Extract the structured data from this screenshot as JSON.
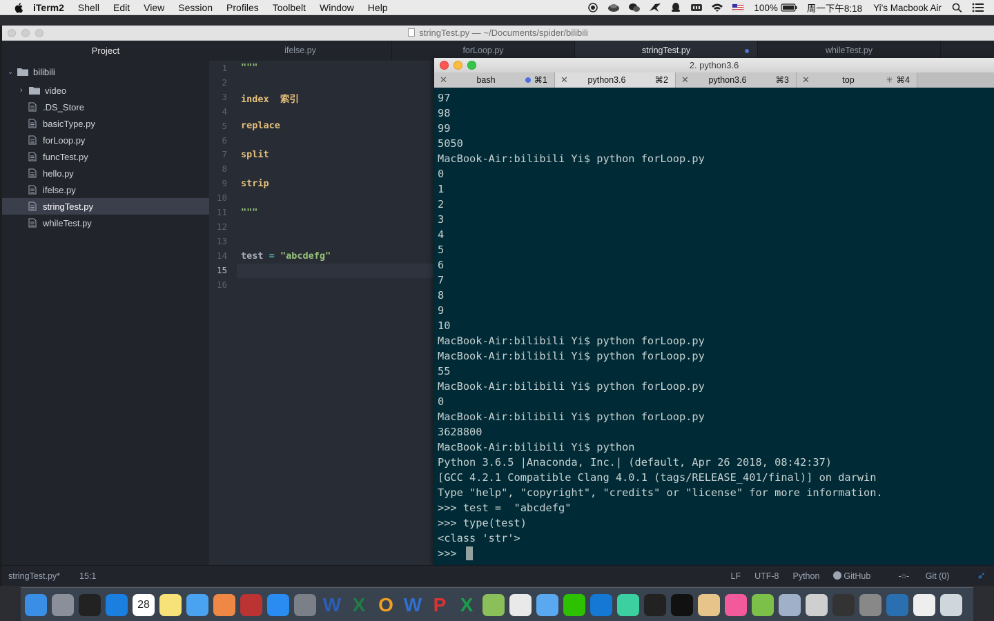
{
  "menubar": {
    "app": "iTerm2",
    "items": [
      "Shell",
      "Edit",
      "View",
      "Session",
      "Profiles",
      "Toolbelt",
      "Window",
      "Help"
    ],
    "battery": "100%",
    "datetime": "周一下午8:18",
    "computer_name": "Yi's Macbook Air"
  },
  "window_title": "stringTest.py — ~/Documents/spider/bilibili",
  "project": {
    "header": "Project",
    "root": "bilibili",
    "folder": "video",
    "files": [
      ".DS_Store",
      "basicType.py",
      "forLoop.py",
      "funcTest.py",
      "hello.py",
      "ifelse.py",
      "stringTest.py",
      "whileTest.py"
    ],
    "selected": "stringTest.py"
  },
  "editor_tabs": [
    "ifelse.py",
    "forLoop.py",
    "stringTest.py",
    "whileTest.py"
  ],
  "active_tab": "stringTest.py",
  "editor": {
    "line_numbers": [
      "1",
      "2",
      "3",
      "4",
      "5",
      "6",
      "7",
      "8",
      "9",
      "10",
      "11",
      "12",
      "13",
      "14",
      "15",
      "16"
    ],
    "lines": {
      "l1": "\"\"\"",
      "l3a": "index",
      "l3b": "索引",
      "l5": "replace",
      "l7": "split",
      "l9": "strip",
      "l11": "\"\"\"",
      "l14a": "test",
      "l14b": "=",
      "l14c": "\"abcdefg\""
    },
    "colors": {
      "string": "#98c379",
      "keyword": "#e5c07b",
      "text": "#abb2bf"
    }
  },
  "terminal": {
    "title": "2. python3.6",
    "tabs": [
      {
        "name": "bash",
        "shortcut": "⌘1"
      },
      {
        "name": "python3.6",
        "shortcut": "⌘2"
      },
      {
        "name": "python3.6",
        "shortcut": "⌘3"
      },
      {
        "name": "top",
        "shortcut": "⌘4"
      }
    ],
    "lines": [
      "97",
      "98",
      "99",
      "5050",
      "MacBook-Air:bilibili Yi$ python forLoop.py",
      "0",
      "1",
      "2",
      "3",
      "4",
      "5",
      "6",
      "7",
      "8",
      "9",
      "10",
      "MacBook-Air:bilibili Yi$ python forLoop.py",
      "MacBook-Air:bilibili Yi$ python forLoop.py",
      "55",
      "MacBook-Air:bilibili Yi$ python forLoop.py",
      "0",
      "MacBook-Air:bilibili Yi$ python forLoop.py",
      "3628800",
      "MacBook-Air:bilibili Yi$ python",
      "Python 3.6.5 |Anaconda, Inc.| (default, Apr 26 2018, 08:42:37)",
      "[GCC 4.2.1 Compatible Clang 4.0.1 (tags/RELEASE_401/final)] on darwin",
      "Type \"help\", \"copyright\", \"credits\" or \"license\" for more information.",
      ">>> test =  \"abcdefg\"",
      ">>> type(test)",
      "<class 'str'>",
      ">>> "
    ]
  },
  "status": {
    "file": "stringTest.py*",
    "position": "15:1",
    "line_ending": "LF",
    "encoding": "UTF-8",
    "grammar": "Python",
    "github": "GitHub",
    "git": "Git (0)"
  },
  "dock": {
    "calendar_day": "28",
    "icons": [
      "finder-icon",
      "launchpad-icon",
      "terminal-icon",
      "safari-icon",
      "calendar-icon",
      "notes-icon",
      "messages-icon",
      "photos-icon",
      "photo-booth-icon",
      "app-store-icon",
      "system-preferences-icon",
      "word-icon",
      "excel-icon",
      "outlook-icon",
      "word-alt-icon",
      "powerpoint-icon",
      "excel-alt-icon",
      "network-icon",
      "chrome-icon",
      "mail-icon",
      "wechat-icon",
      "vpn-icon",
      "atom-icon",
      "activity-monitor-icon",
      "qq-icon",
      "folder-icon",
      "itunes-icon",
      "sublime-icon",
      "network-radar-icon",
      "automator-icon",
      "terminal-alt-icon",
      "archive-icon",
      "quicktime-icon",
      "documents-icon",
      "trash-icon"
    ]
  }
}
